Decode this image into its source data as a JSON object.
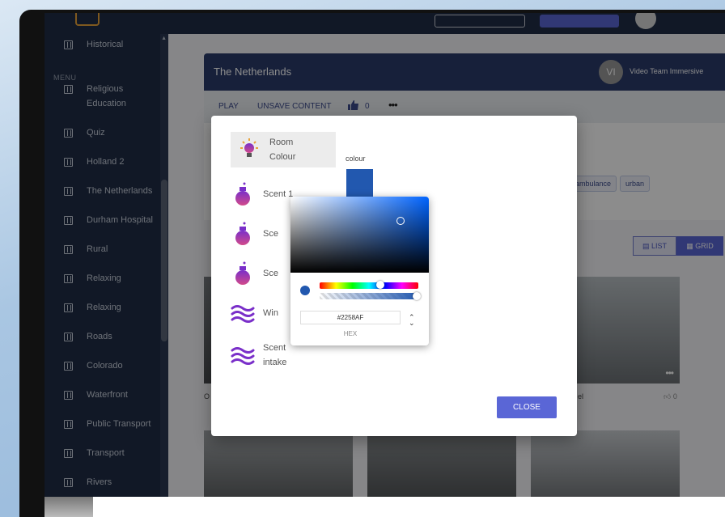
{
  "sidebar": {
    "menu_heading": "MENU",
    "items": [
      {
        "label": "Historical"
      },
      {
        "label": "Religious Education"
      },
      {
        "label": "Quiz"
      },
      {
        "label": "Holland 2"
      },
      {
        "label": "The Netherlands"
      },
      {
        "label": "Durham Hospital"
      },
      {
        "label": "Rural"
      },
      {
        "label": "Relaxing"
      },
      {
        "label": "Relaxing"
      },
      {
        "label": "Roads"
      },
      {
        "label": "Colorado"
      },
      {
        "label": "Waterfront"
      },
      {
        "label": "Public Transport"
      },
      {
        "label": "Transport"
      },
      {
        "label": "Rivers"
      }
    ]
  },
  "content": {
    "title": "The Netherlands",
    "owner_initials": "VI",
    "owner_name": "Video Team Immersive",
    "actions": {
      "play": "PLAY",
      "unsave": "UNSAVE CONTENT",
      "likes": "0"
    },
    "tags": [
      "ambulance",
      "urban"
    ],
    "view": {
      "list": "LIST",
      "grid": "GRID",
      "selected": "GRID"
    },
    "tile_captions": [
      "O",
      "el"
    ],
    "tile_likes": "0"
  },
  "modal": {
    "options": [
      {
        "label": "Room Colour",
        "icon": "lightbulb-icon",
        "selected": true
      },
      {
        "label": "Scent 1",
        "icon": "perfume-bottle-icon"
      },
      {
        "label": "Sce",
        "icon": "perfume-bottle-icon"
      },
      {
        "label": "Sce",
        "icon": "perfume-bottle-icon"
      },
      {
        "label": "Win",
        "icon": "wind-icon"
      },
      {
        "label": "Scent intake",
        "icon": "wind-icon"
      }
    ],
    "colour_label": "colour",
    "colour_value": "#2258af",
    "close_label": "CLOSE"
  },
  "picker": {
    "hex_value": "#2258AF",
    "mode_label": "HEX"
  },
  "colors": {
    "sidebar_bg": "#1f2c45",
    "accent": "#5a66d6",
    "header_bg": "#2a3b6b",
    "icon_purple_start": "#7a2fc9",
    "icon_purple_end": "#d24a8a"
  }
}
